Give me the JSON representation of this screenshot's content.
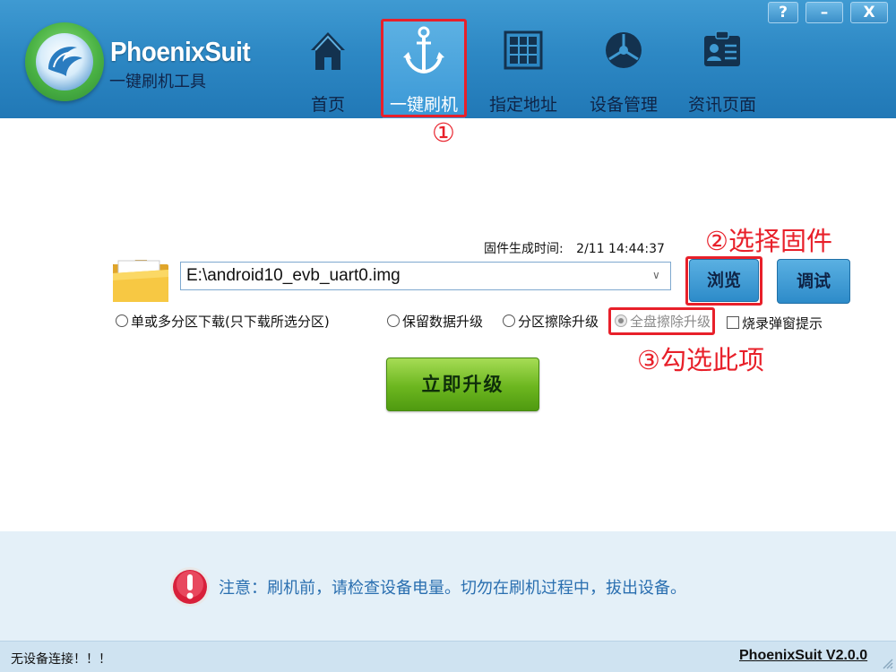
{
  "app": {
    "title": "PhoenixSuit",
    "subtitle": "一键刷机工具"
  },
  "window_buttons": {
    "help": "?",
    "minimize": "–",
    "close": "X"
  },
  "nav": {
    "items": [
      {
        "label": "首页",
        "icon": "home-icon"
      },
      {
        "label": "一键刷机",
        "icon": "anchor-icon",
        "active": true
      },
      {
        "label": "指定地址",
        "icon": "grid-icon"
      },
      {
        "label": "设备管理",
        "icon": "aperture-icon"
      },
      {
        "label": "资讯页面",
        "icon": "id-card-icon"
      }
    ]
  },
  "annotations": {
    "step1": "①",
    "step2": "②选择固件",
    "step3": "③勾选此项"
  },
  "firmware": {
    "time_label": "固件生成时间:",
    "time_value": "2/11 14:44:37",
    "path": "E:\\android10_evb_uart0.img",
    "browse_label": "浏览",
    "debug_label": "调试"
  },
  "options": {
    "single_multi": "单或多分区下载(只下载所选分区)",
    "keep_data": "保留数据升级",
    "partition_erase": "分区擦除升级",
    "full_erase": "全盘擦除升级",
    "burn_popup": "烧录弹窗提示"
  },
  "upgrade": {
    "label": "立即升级"
  },
  "notice": {
    "text": "注意：刷机前，请检查设备电量。切勿在刷机过程中，拔出设备。"
  },
  "status": {
    "left": "无设备连接！！！",
    "right": "PhoenixSuit V2.0.0"
  },
  "colors": {
    "header": "#2d88c4",
    "annotation_red": "#e8202a",
    "upgrade_green": "#6cb61f",
    "notice_text": "#2a6fb0"
  }
}
